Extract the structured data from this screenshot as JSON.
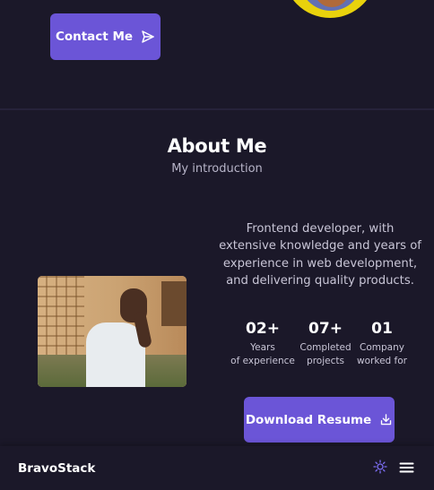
{
  "hero": {
    "contact_label": "Contact Me",
    "contact_icon": "send-icon"
  },
  "about": {
    "title": "About Me",
    "subtitle": "My introduction",
    "bio_lines": [
      "Frontend developer, with",
      "extensive knowledge and years of",
      "experience in web development,",
      "and delivering quality products."
    ],
    "photo_icon": "profile-photo",
    "stats": [
      {
        "value": "02+",
        "label_line1": "Years",
        "label_line2": "of experience"
      },
      {
        "value": "07+",
        "label_line1": "Completed",
        "label_line2": "projects"
      },
      {
        "value": "01",
        "label_line1": "Company",
        "label_line2": "worked for"
      }
    ],
    "download_label": "Download Resume",
    "download_icon": "download-icon"
  },
  "footer_nav": {
    "brand": "BravoStack",
    "theme_icon": "sun-icon",
    "menu_icon": "hamburger-menu-icon"
  },
  "colors": {
    "background": "#1b1829",
    "accent": "#6b55d7",
    "text_muted": "#c8c5d6",
    "theme_icon": "#7b6cf0"
  }
}
